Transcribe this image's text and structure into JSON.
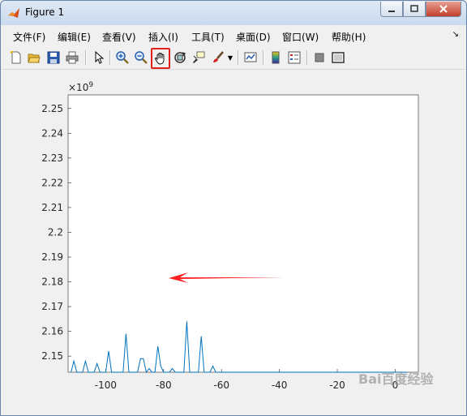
{
  "window": {
    "title": "Figure 1"
  },
  "menu": [
    "文件(F)",
    "编辑(E)",
    "查看(V)",
    "插入(I)",
    "工具(T)",
    "桌面(D)",
    "窗口(W)",
    "帮助(H)"
  ],
  "toolbar": {
    "tools": [
      "new-figure",
      "open-file",
      "save-figure",
      "print-figure",
      "edit-plot",
      "zoom-in",
      "zoom-out",
      "pan",
      "rotate-3d",
      "data-cursor",
      "brush",
      "link-plot",
      "colorbar",
      "legend",
      "hide-plot-tools",
      "show-plot-tools"
    ],
    "active_tool": "pan"
  },
  "chart_data": {
    "type": "line",
    "exponent_label": "× 10^9",
    "xlim": [
      -113,
      8
    ],
    "ylim": [
      2.1435,
      2.2555
    ],
    "x_ticks": [
      -100,
      -80,
      -60,
      -40,
      -20,
      0
    ],
    "y_ticks": [
      2.15,
      2.16,
      2.17,
      2.18,
      2.19,
      2.2,
      2.21,
      2.22,
      2.23,
      2.24,
      2.25
    ],
    "series": [
      {
        "color": "#0072bd",
        "x": [
          -112,
          -111,
          -110,
          -109,
          -108,
          -107,
          -106,
          -105,
          -104,
          -103,
          -102,
          -101,
          -100,
          -99,
          -98,
          -97,
          -96,
          -95,
          -94,
          -93,
          -92,
          -91,
          -90,
          -89,
          -88,
          -87,
          -86,
          -85,
          -84,
          -83,
          -82,
          -81,
          -80,
          -79,
          -78,
          -77,
          -76,
          -75,
          -74,
          -73,
          -72,
          -71,
          -70,
          -69,
          -68,
          -67,
          -66,
          -65,
          -64,
          -63,
          -62,
          -61,
          -60,
          -59,
          -58,
          -57,
          -56,
          -55,
          -54,
          -53,
          -52,
          -51,
          -50,
          -49,
          -48,
          -47,
          -46,
          -45,
          -44,
          -43,
          -42,
          -41,
          -40,
          -39,
          -38,
          -37,
          -36,
          -35,
          -34,
          -33,
          -32,
          -31,
          -30,
          -29,
          -28,
          -27,
          -26,
          -25,
          -24,
          -23,
          -22,
          -21,
          -20,
          -19,
          -18,
          -17,
          -16,
          -15,
          -14,
          -13,
          -12,
          -11,
          -10,
          -9,
          -8,
          -7,
          -6,
          -5,
          -4,
          -3,
          -2,
          -1,
          0,
          1,
          2,
          3,
          4
        ],
        "y": [
          2.1435,
          2.148,
          2.1435,
          2.1435,
          2.1435,
          2.148,
          2.1435,
          2.1435,
          2.1435,
          2.147,
          2.1435,
          2.1435,
          2.1435,
          2.152,
          2.1435,
          2.1435,
          2.1435,
          2.1435,
          2.1435,
          2.159,
          2.1435,
          2.1435,
          2.1435,
          2.1435,
          2.149,
          2.149,
          2.1435,
          2.145,
          2.1435,
          2.1435,
          2.154,
          2.146,
          2.1435,
          2.1435,
          2.1435,
          2.145,
          2.1435,
          2.1435,
          2.1435,
          2.1435,
          2.164,
          2.1435,
          2.1435,
          2.1435,
          2.1435,
          2.158,
          2.1435,
          2.1435,
          2.1435,
          2.146,
          2.1435,
          2.1435,
          2.1435,
          2.1435,
          2.1435,
          2.1435,
          2.1435,
          2.1435,
          2.1435,
          2.1435,
          2.1435,
          2.1435,
          2.1435,
          2.1435,
          2.1435,
          2.1435,
          2.1435,
          2.1435,
          2.1435,
          2.1435,
          2.1435,
          2.1435,
          2.1435,
          2.1435,
          2.1435,
          2.1435,
          2.1435,
          2.1435,
          2.1435,
          2.1435,
          2.1435,
          2.1435,
          2.1435,
          2.1435,
          2.1435,
          2.1435,
          2.1435,
          2.1435,
          2.1435,
          2.1435,
          2.1435,
          2.1435,
          2.1435,
          2.1435,
          2.1435,
          2.1435,
          2.1435,
          2.1435,
          2.1435,
          2.1435,
          2.1435,
          2.1435,
          2.1435,
          2.1435,
          2.1435,
          2.1435,
          2.1435,
          2.1435,
          2.1435,
          2.1435,
          2.1435,
          2.1435,
          2.1435,
          2.1435,
          2.1435,
          2.1435,
          2.1435
        ]
      }
    ]
  },
  "watermark": "Bai百度经验"
}
